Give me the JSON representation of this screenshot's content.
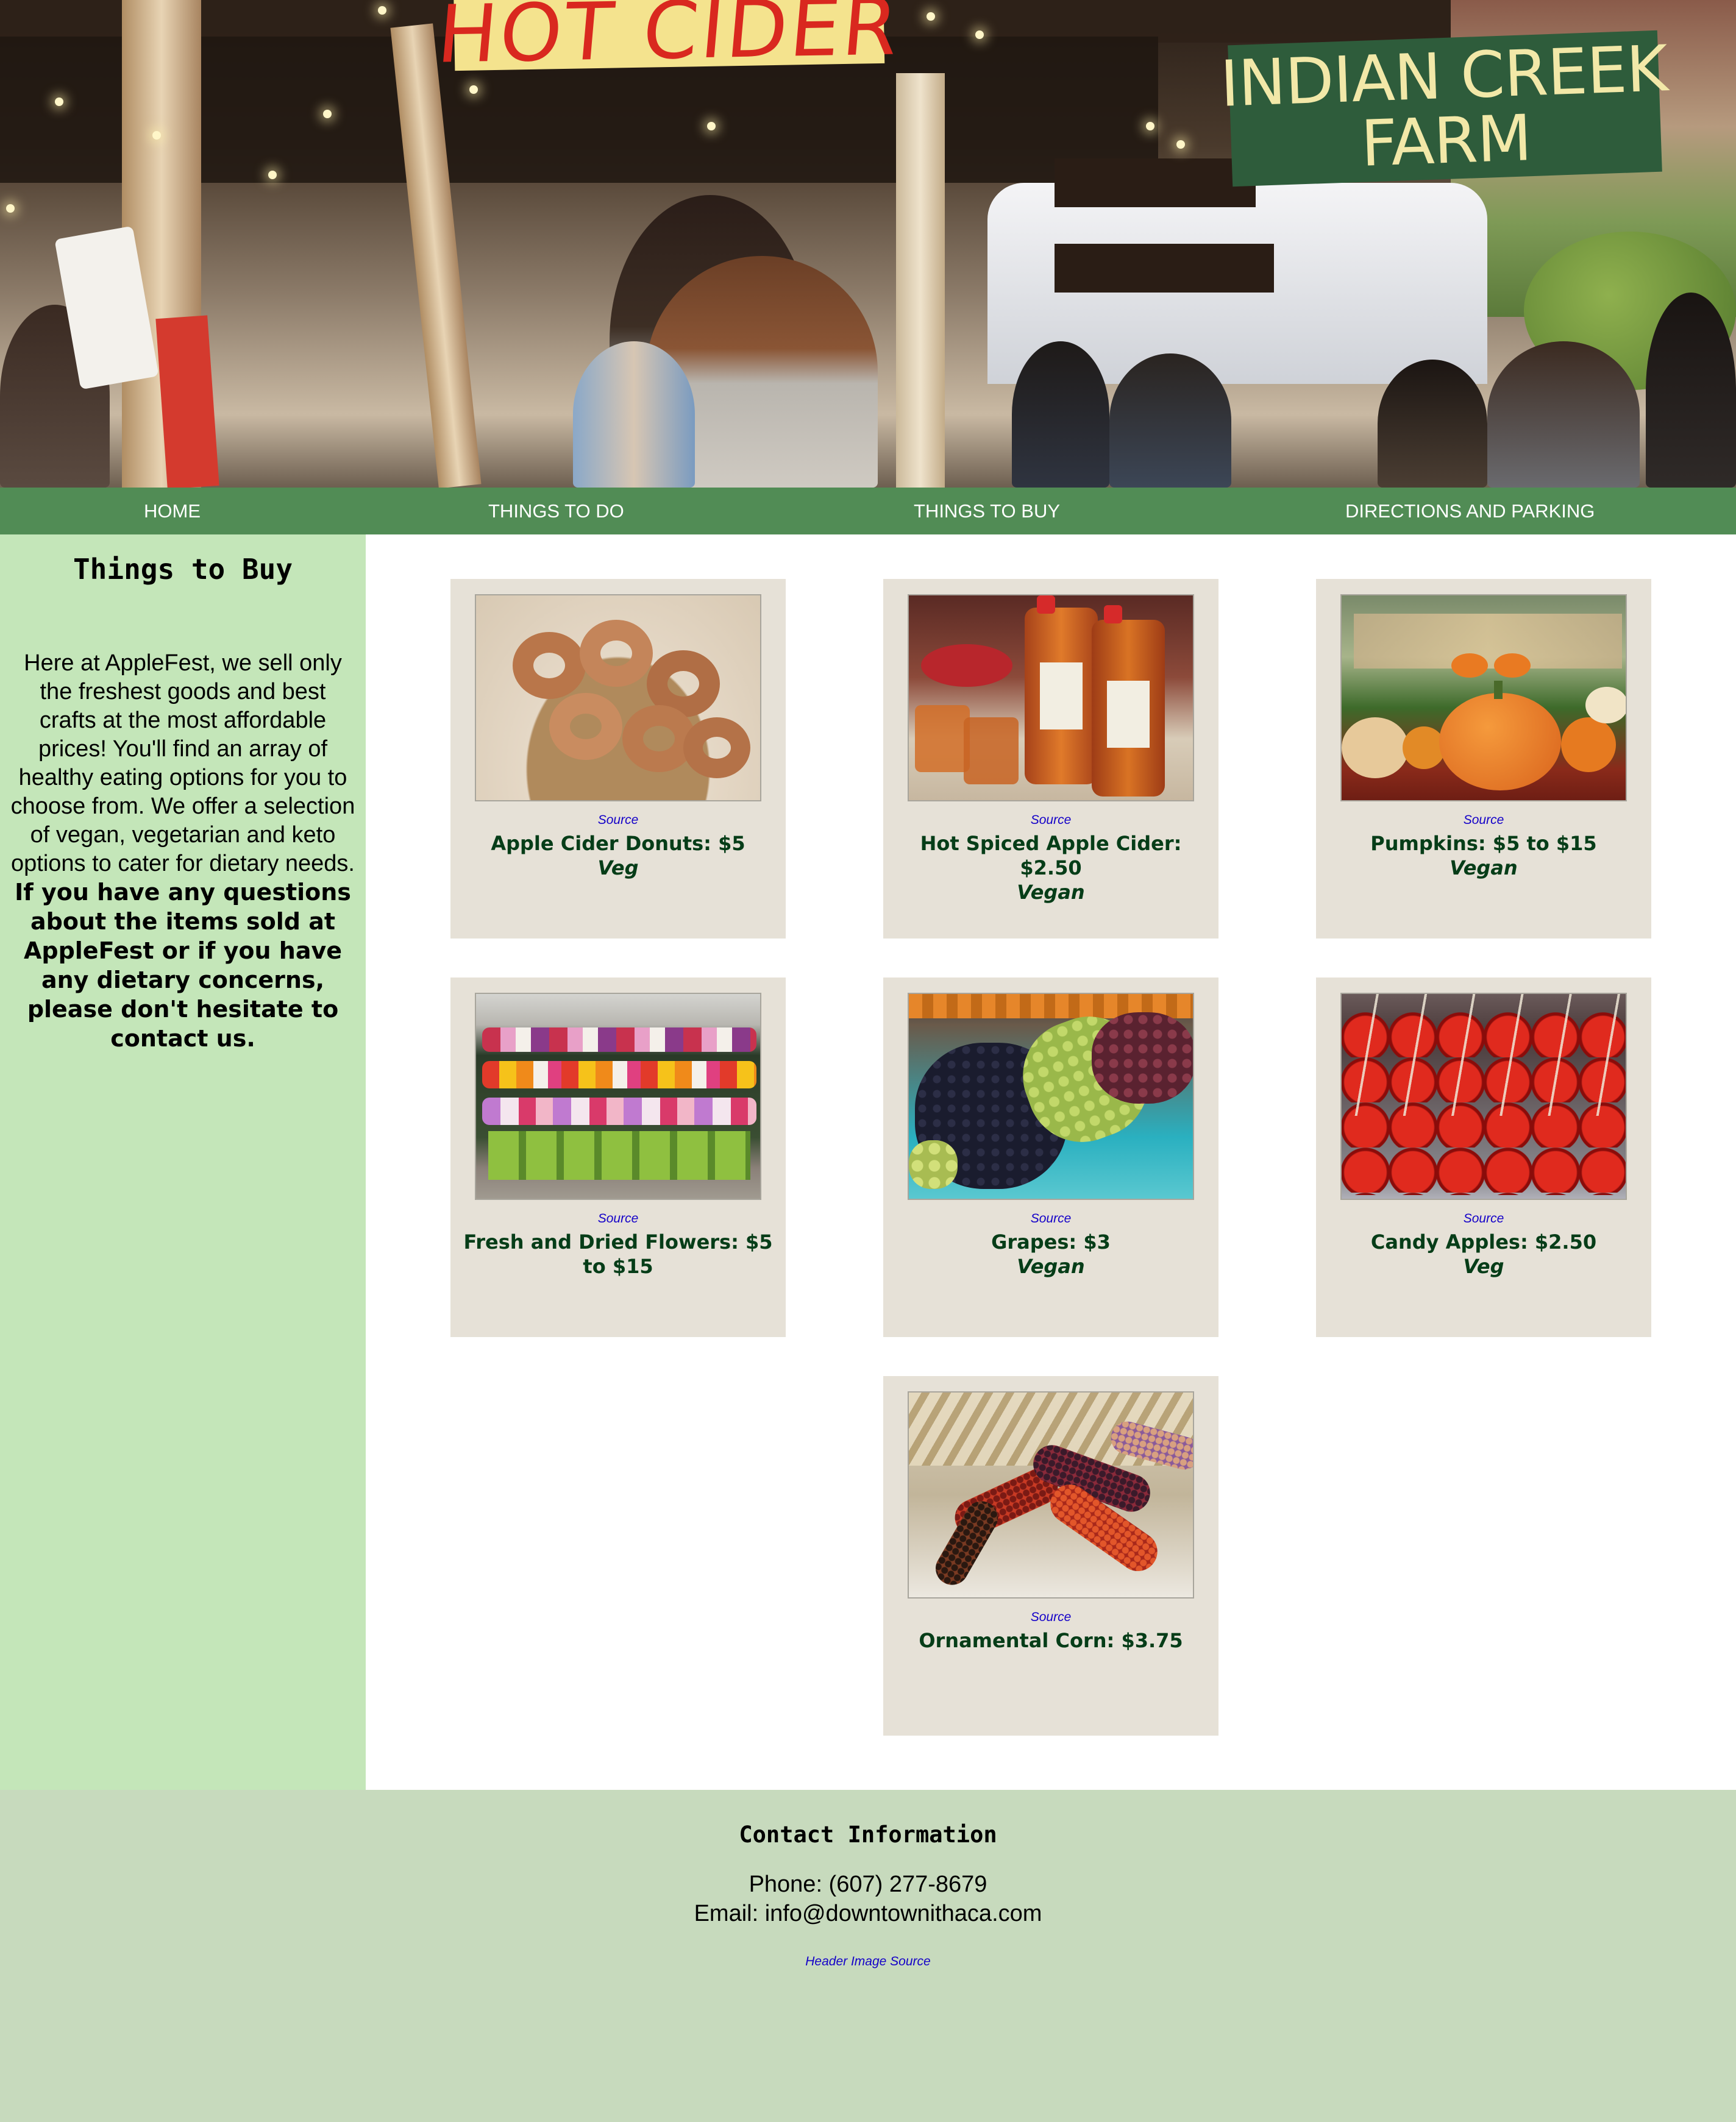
{
  "header": {
    "sign_left": "HOT CIDER",
    "sign_right_line1": "INDIAN CREEK",
    "sign_right_line2": "FARM"
  },
  "nav": {
    "items": [
      {
        "label": "HOME"
      },
      {
        "label": "THINGS TO DO"
      },
      {
        "label": "THINGS TO BUY"
      },
      {
        "label": "DIRECTIONS AND PARKING"
      }
    ]
  },
  "sidebar": {
    "title": "Things to Buy",
    "intro": "Here at AppleFest, we sell only the freshest goods and best crafts at the most affordable prices! You'll find an array of healthy eating options for you to choose from. We offer a selection of vegan, vegetarian and keto options to cater for dietary needs. ",
    "intro_bold": "If you have any questions about the items sold at AppleFest or if you have any dietary concerns, please don't hesitate to contact us."
  },
  "products": [
    {
      "source_label": "Source",
      "name": "Apple Cider Donuts: $5",
      "diet": "Veg",
      "icon": "donuts-photo"
    },
    {
      "source_label": "Source",
      "name": "Hot Spiced Apple Cider: $2.50",
      "diet": "Vegan",
      "icon": "cider-photo"
    },
    {
      "source_label": "Source",
      "name": "Pumpkins: $5 to $15",
      "diet": "Vegan",
      "icon": "pumpkins-photo"
    },
    {
      "source_label": "Source",
      "name": "Fresh and Dried Flowers: $5 to $15",
      "diet": "",
      "icon": "flowers-photo"
    },
    {
      "source_label": "Source",
      "name": "Grapes: $3",
      "diet": "Vegan",
      "icon": "grapes-photo"
    },
    {
      "source_label": "Source",
      "name": "Candy Apples: $2.50",
      "diet": "Veg",
      "icon": "candy-apples-photo"
    },
    {
      "source_label": "Source",
      "name": "Ornamental Corn: $3.75",
      "diet": "",
      "icon": "corn-photo"
    }
  ],
  "footer": {
    "title": "Contact Information",
    "phone": "Phone: (607) 277-8679",
    "email": "Email: info@downtownithaca.com",
    "header_source": "Header Image Source"
  },
  "colors": {
    "nav_bg": "#518c55",
    "sidebar_bg": "#c4e6b9",
    "card_bg": "#e6e1d7",
    "footer_bg": "#c7dabd",
    "link": "#1400c8",
    "product_text": "#063d18"
  }
}
